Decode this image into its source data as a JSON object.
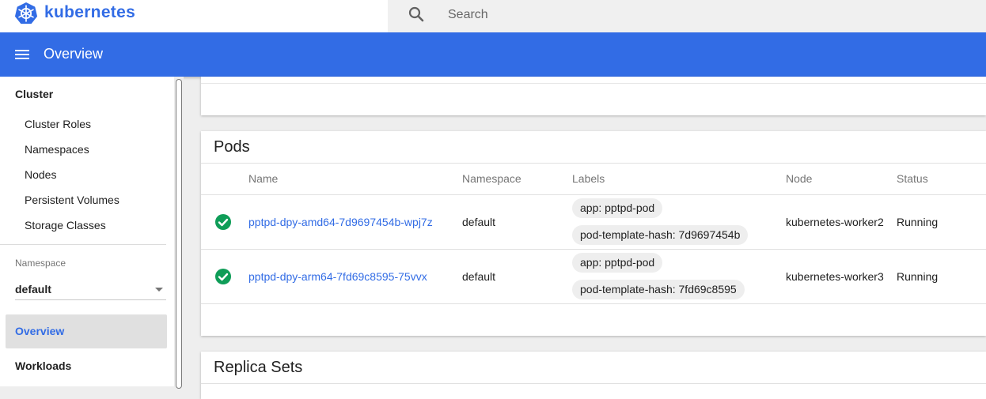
{
  "brand": {
    "name": "kubernetes"
  },
  "search": {
    "placeholder": "Search"
  },
  "header": {
    "title": "Overview"
  },
  "sidebar": {
    "cluster_heading": "Cluster",
    "cluster_items": [
      "Cluster Roles",
      "Namespaces",
      "Nodes",
      "Persistent Volumes",
      "Storage Classes"
    ],
    "namespace_label": "Namespace",
    "namespace_value": "default",
    "active_item": "Overview",
    "workloads_heading": "Workloads"
  },
  "pods": {
    "title": "Pods",
    "columns": [
      "Name",
      "Namespace",
      "Labels",
      "Node",
      "Status"
    ],
    "rows": [
      {
        "name": "pptpd-dpy-amd64-7d9697454b-wpj7z",
        "namespace": "default",
        "labels": [
          "app: pptpd-pod",
          "pod-template-hash: 7d9697454b"
        ],
        "node": "kubernetes-worker2",
        "status": "Running"
      },
      {
        "name": "pptpd-dpy-arm64-7fd69c8595-75vvx",
        "namespace": "default",
        "labels": [
          "app: pptpd-pod",
          "pod-template-hash: 7fd69c8595"
        ],
        "node": "kubernetes-worker3",
        "status": "Running"
      }
    ]
  },
  "replica_sets": {
    "title": "Replica Sets"
  },
  "colors": {
    "accent": "#326ce5",
    "success": "#0f9d58"
  }
}
